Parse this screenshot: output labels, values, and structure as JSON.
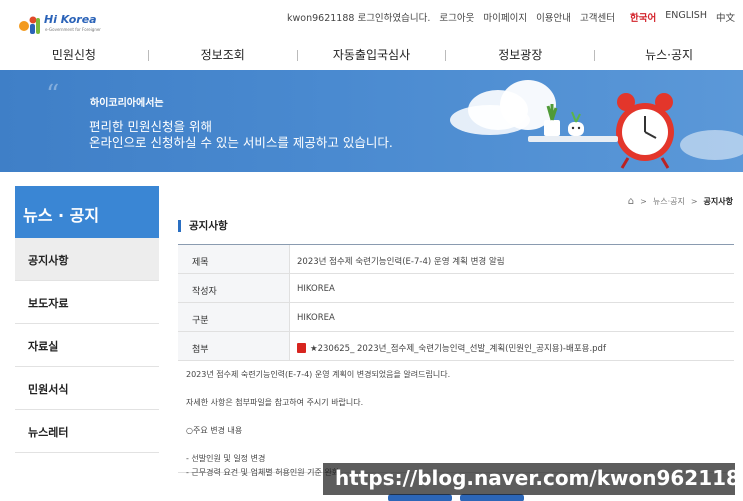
{
  "header": {
    "logo_text": "Hi Korea",
    "logo_sub": "e-Government for Foreigner",
    "user_status": "kwon9621188 로그인하였습니다.",
    "util_links": [
      "로그아웃",
      "마이페이지",
      "이용안내",
      "고객센터"
    ],
    "languages": [
      "한국어",
      "ENGLISH",
      "中文"
    ]
  },
  "nav": {
    "items": [
      "민원신청",
      "정보조회",
      "자동출입국심사",
      "정보광장",
      "뉴스·공지"
    ]
  },
  "banner": {
    "small": "하이코리아에서는",
    "line1": "편리한 민원신청을 위해",
    "line2": "온라인으로 신청하실 수 있는 서비스를 제공하고 있습니다."
  },
  "sidebar": {
    "title": "뉴스 · 공지",
    "items": [
      "공지사항",
      "보도자료",
      "자료실",
      "민원서식",
      "뉴스레터"
    ],
    "active": "공지사항"
  },
  "breadcrumb": {
    "home": "⌂",
    "sep": ">",
    "parent": "뉴스·공지",
    "current": "공지사항"
  },
  "section_title": "공지사항",
  "notice": {
    "rows": [
      {
        "label": "제목",
        "value": "2023년 점수제 숙련기능인력(E-7-4) 운영 계획 변경 알림"
      },
      {
        "label": "작성자",
        "value": "HIKOREA"
      },
      {
        "label": "구분",
        "value": "HIKOREA"
      },
      {
        "label": "첨부",
        "value": "★230625_ 2023년_점수제_숙련기능인력_선발_계획(민원인_공지용)-배포용.pdf"
      }
    ],
    "body": [
      "2023년 점수제 숙련기능인력(E-7-4) 운영 계획이 변경되었음을 알려드립니다.",
      "",
      "자세한 사항은 첨부파일을 참고하여 주시기 바랍니다.",
      "",
      "○주요 변경 내용",
      "",
      " - 선발인원 및 일정 변경",
      " - 근무경력 요건 및 업체별 허용인원 기준 완화"
    ]
  },
  "watermark": "https://blog.naver.com/kwon9621188",
  "colors": {
    "accent": "#3a86d4",
    "banner": "#4a8ad0",
    "lang_active": "#d3222a"
  }
}
